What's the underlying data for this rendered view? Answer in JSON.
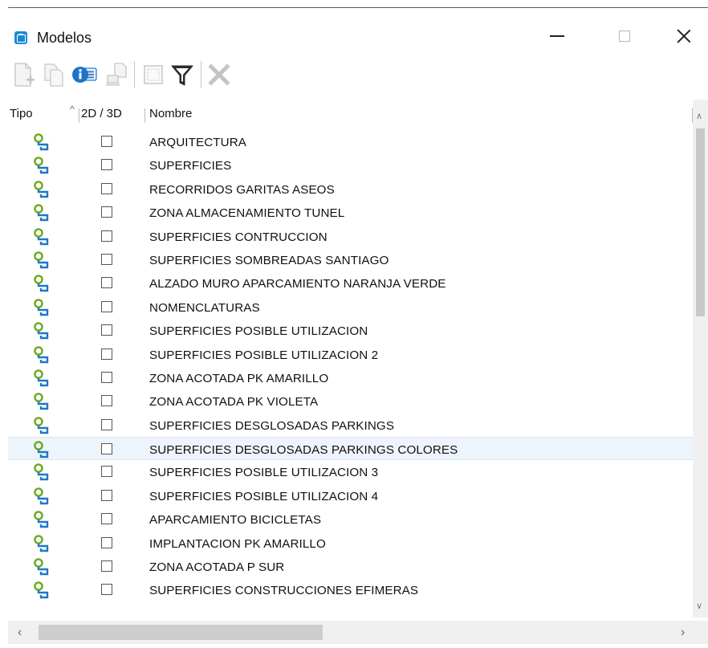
{
  "window": {
    "title": "Modelos",
    "minimize_icon": "minimize-icon",
    "maximize_icon": "maximize-icon",
    "close_icon": "close-icon"
  },
  "toolbar": {
    "buttons": [
      {
        "name": "new-model-button",
        "icon": "new-document-icon",
        "enabled": false
      },
      {
        "name": "copy-model-button",
        "icon": "copy-icon",
        "enabled": false
      },
      {
        "name": "model-properties-button",
        "icon": "info-list-icon",
        "enabled": true
      },
      {
        "name": "export-model-button",
        "icon": "export-icon",
        "enabled": false
      },
      {
        "name": "select-all-button",
        "icon": "select-box-icon",
        "enabled": false
      },
      {
        "name": "filter-button",
        "icon": "filter-funnel-icon",
        "enabled": true
      },
      {
        "name": "delete-model-button",
        "icon": "delete-x-icon",
        "enabled": false
      }
    ]
  },
  "table": {
    "columns": {
      "tipo": "Tipo",
      "dim": "2D / 3D",
      "nombre": "Nombre"
    },
    "sort_column": "tipo",
    "highlighted_row": 13,
    "rows": [
      {
        "name": "ARQUITECTURA"
      },
      {
        "name": "SUPERFICIES"
      },
      {
        "name": "RECORRIDOS GARITAS ASEOS"
      },
      {
        "name": "ZONA ALMACENAMIENTO TUNEL"
      },
      {
        "name": "SUPERFICIES CONTRUCCION"
      },
      {
        "name": "SUPERFICIES SOMBREADAS SANTIAGO"
      },
      {
        "name": "ALZADO MURO APARCAMIENTO NARANJA VERDE"
      },
      {
        "name": "NOMENCLATURAS"
      },
      {
        "name": "SUPERFICIES POSIBLE UTILIZACION"
      },
      {
        "name": "SUPERFICIES POSIBLE UTILIZACION 2"
      },
      {
        "name": "ZONA ACOTADA PK AMARILLO"
      },
      {
        "name": "ZONA ACOTADA PK VIOLETA"
      },
      {
        "name": "SUPERFICIES DESGLOSADAS PARKINGS"
      },
      {
        "name": "SUPERFICIES DESGLOSADAS PARKINGS  COLORES"
      },
      {
        "name": "SUPERFICIES POSIBLE UTILIZACION 3"
      },
      {
        "name": "SUPERFICIES POSIBLE UTILIZACION 4"
      },
      {
        "name": "APARCAMIENTO BICICLETAS"
      },
      {
        "name": "IMPLANTACION PK AMARILLO"
      },
      {
        "name": "ZONA ACOTADA P SUR"
      },
      {
        "name": "SUPERFICIES CONSTRUCCIONES EFIMERAS"
      }
    ]
  },
  "colors": {
    "accent": "#1a8ad6",
    "type_icon_green": "#6aaa1e",
    "type_icon_blue": "#1e78c8",
    "highlight_row": "#eef4fb"
  },
  "scrollbars": {
    "vertical_up_icon": "scroll-up-icon",
    "vertical_down_icon": "scroll-down-icon",
    "horizontal_left_icon": "scroll-left-icon",
    "horizontal_right_icon": "scroll-right-icon"
  }
}
